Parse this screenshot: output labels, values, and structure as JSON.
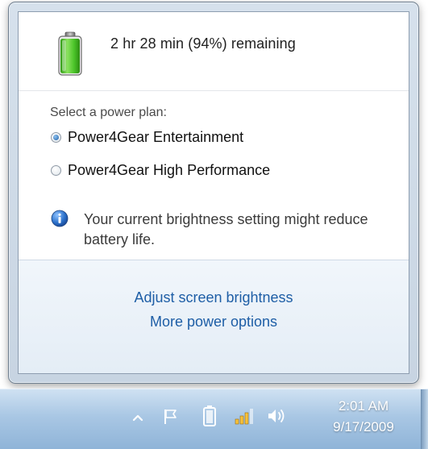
{
  "flyout": {
    "status": {
      "battery_icon": "battery-charged-icon",
      "remaining_text": "2 hr 28 min (94%) remaining",
      "battery_percent": 94
    },
    "plan": {
      "heading": "Select a power plan:",
      "options": [
        {
          "label": "Power4Gear Entertainment",
          "selected": true
        },
        {
          "label": "Power4Gear High Performance",
          "selected": false
        }
      ]
    },
    "info": {
      "icon": "info-icon",
      "message": "Your current brightness setting might reduce battery life."
    },
    "links": {
      "adjust_brightness": "Adjust screen brightness",
      "more_options": "More power options"
    }
  },
  "taskbar": {
    "tray_icons": [
      "show-hidden-icons-chevron-icon",
      "action-center-flag-icon",
      "battery-icon",
      "network-signal-icon",
      "volume-icon"
    ],
    "clock": {
      "time": "2:01 AM",
      "date": "9/17/2009"
    }
  },
  "colors": {
    "link": "#1e5ea6",
    "battery_fill": "#4cc52a",
    "info_blue": "#2a6fc9",
    "taskbar_top": "#cfe1f2",
    "taskbar_bottom": "#8fb4d8"
  }
}
